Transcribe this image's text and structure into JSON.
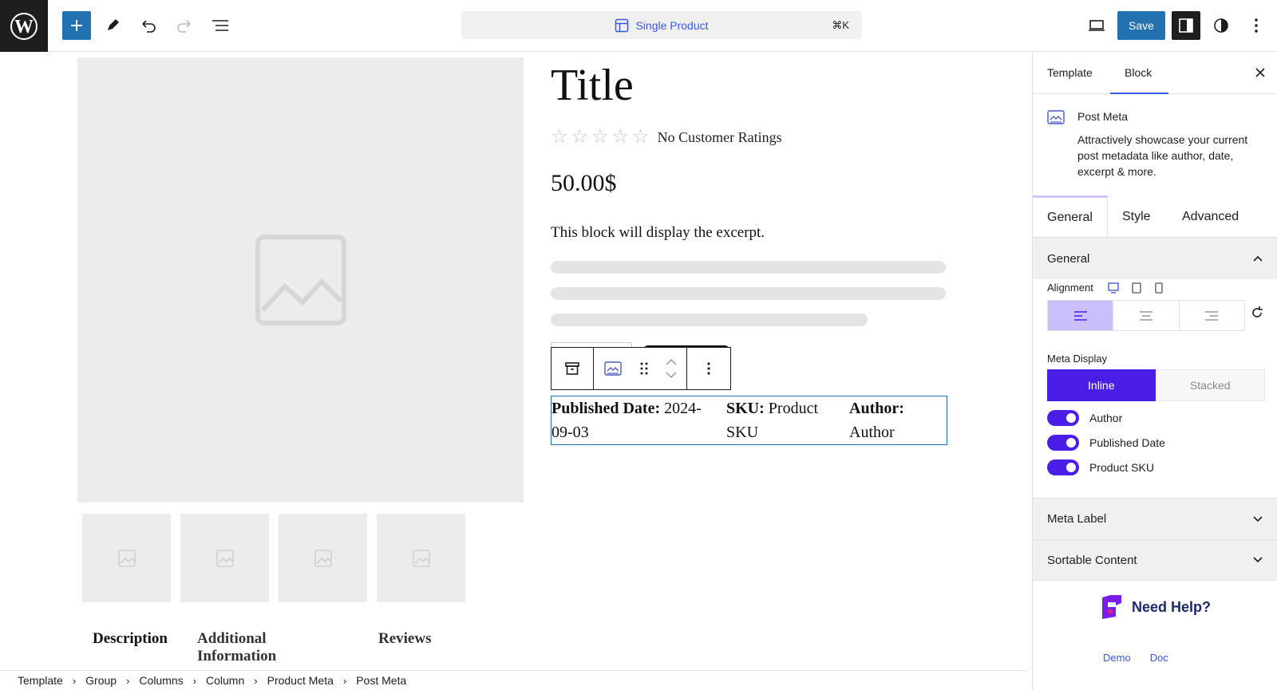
{
  "topbar": {
    "command_label": "Single Product",
    "command_shortcut": "⌘K",
    "save_label": "Save"
  },
  "canvas": {
    "title": "Title",
    "rating_text": "No Customer Ratings",
    "price": "50.00$",
    "excerpt": "This block will display the excerpt.",
    "post_meta": {
      "published_label": "Published Date:",
      "published_value": " 2024-09-03",
      "sku_label": "SKU:",
      "sku_value": " Product SKU",
      "author_label": "Author:",
      "author_value": " Author"
    },
    "tabs": [
      "Description",
      "Additional Information",
      "Reviews"
    ]
  },
  "breadcrumb": [
    "Template",
    "Group",
    "Columns",
    "Column",
    "Product Meta",
    "Post Meta"
  ],
  "sidebar": {
    "tabs": [
      "Template",
      "Block"
    ],
    "active_tab": "Block",
    "block_card": {
      "title": "Post Meta",
      "description": "Attractively showcase your current post metadata like author, date, excerpt & more."
    },
    "settings_tabs": [
      "General",
      "Style",
      "Advanced"
    ],
    "general_panel": {
      "title": "General",
      "alignment_label": "Alignment",
      "alignment_selected": "left",
      "meta_display_label": "Meta Display",
      "meta_display_options": [
        "Inline",
        "Stacked"
      ],
      "meta_display_selected": "Inline",
      "toggles": [
        {
          "label": "Author",
          "on": true
        },
        {
          "label": "Published Date",
          "on": true
        },
        {
          "label": "Product SKU",
          "on": true
        }
      ]
    },
    "meta_label_panel": "Meta Label",
    "sortable_panel": "Sortable Content",
    "help": {
      "title": "Need Help?",
      "links": [
        "Demo",
        "Doc"
      ]
    }
  },
  "colors": {
    "accent": "#4b1ee8",
    "wp_blue": "#2271b1",
    "selected_align": "#cbbffb"
  }
}
